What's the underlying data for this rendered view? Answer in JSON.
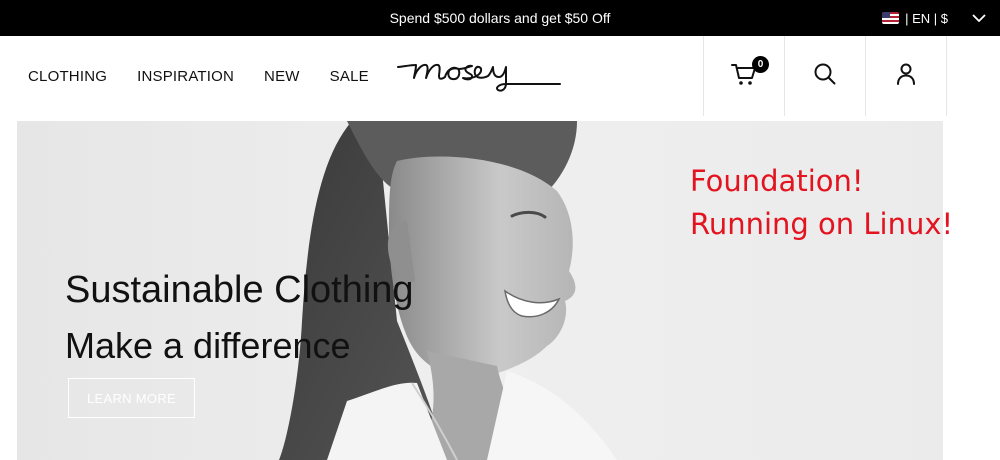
{
  "promo": {
    "text": "Spend $500 dollars and get $50 Off"
  },
  "locale": {
    "text": "| EN | $",
    "flag_icon": "us-flag-icon"
  },
  "nav": {
    "items": [
      {
        "label": "CLOTHING"
      },
      {
        "label": "INSPIRATION"
      },
      {
        "label": "NEW"
      },
      {
        "label": "SALE"
      }
    ]
  },
  "brand": {
    "logo_text": "mosey"
  },
  "header_icons": {
    "cart_icon": "cart-icon",
    "cart_count": "0",
    "search_icon": "search-icon",
    "account_icon": "user-icon"
  },
  "hero": {
    "title": "Sustainable Clothing",
    "subtitle": "Make a difference",
    "cta_label": "LEARN MORE"
  },
  "annotation": {
    "line1": "Foundation!",
    "line2": "Running on Linux!",
    "color": "#e3141f"
  },
  "colors": {
    "promo_bg": "#000000",
    "text": "#111111",
    "hero_bg": "#ececec"
  }
}
